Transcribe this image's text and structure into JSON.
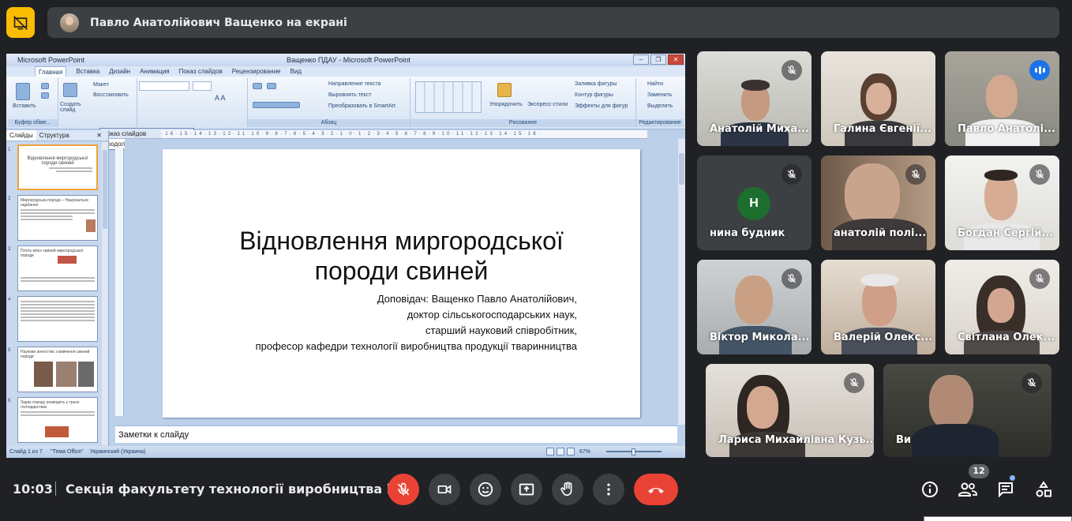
{
  "colors": {
    "accent_yellow": "#fbbc04",
    "end_call": "#ea4335",
    "speaking": "#1a73e8",
    "background": "#202124"
  },
  "presenter_bar": {
    "text": "Павло Анатолійович Ващенко на екрані"
  },
  "powerpoint": {
    "app_name": "Microsoft PowerPoint",
    "window_title": "Ващенко ПДАУ - Microsoft PowerPoint",
    "tabs": [
      "Главная",
      "Вставка",
      "Дизайн",
      "Анимация",
      "Показ слайдов",
      "Рецензирование",
      "Вид"
    ],
    "ribbon": {
      "paste": "Вставить",
      "create_slide": "Создать слайд",
      "maket": "Макет",
      "restore": "Восстановить",
      "clipboard_group": "Буфер обме...",
      "paragraph_group": "Абзац",
      "drawing_group": "Рисование",
      "editing_group": "Редактирование",
      "text_direction": "Направление текста",
      "align_text": "Выровнять текст",
      "smartart": "Преобразовать в SmartArt",
      "arrange": "Упорядочить",
      "quick_styles": "Экспресс-стили",
      "shape_fill": "Заливка фигуры",
      "shape_outline": "Контур фигуры",
      "shape_effects": "Эффекты для фигур",
      "find": "Найти",
      "replace": "Заменить",
      "select": "Выделить"
    },
    "popup": {
      "header": "Показ слайдов",
      "item": "Продолжить показ слайдов"
    },
    "side_tabs": {
      "slides": "Слайды",
      "outline": "Структура"
    },
    "thumbnails": [
      {
        "num": "1",
        "title": "Відновлення миргородської породи свиней"
      },
      {
        "num": "2",
        "title": "Миргородська порода – Національне надбання"
      },
      {
        "num": "3",
        "title": "Плоть мясо свиней миргородської породи"
      },
      {
        "num": "4",
        "title": ""
      },
      {
        "num": "5",
        "title": "Наукове агентство з вивчення свиней породи"
      },
      {
        "num": "6",
        "title": "Зараз породу розводять у трьох господарствах"
      }
    ],
    "ruler_text": "·16·15·14·13·12·11·10·9·8·7·6·5·4·3·2·1·0·1·2·3·4·5·6·7·8·9·10·11·12·13·14·15·16·",
    "slide": {
      "title_line1": "Відновлення миргородської",
      "title_line2": "породи свиней",
      "sub_line1": "Доповідач: Ващенко Павло Анатолійович,",
      "sub_line2": "доктор сільськогосподарських наук,",
      "sub_line3": "старший науковий співробітник,",
      "sub_line4": "професор кафедри технології виробництва продукції тваринництва"
    },
    "notes_placeholder": "Заметки к слайду",
    "status": {
      "slide_of": "Слайд 1 из 7",
      "theme": "\"Тема Office\"",
      "language": "Украинский (Украина)",
      "zoom": "67%"
    }
  },
  "participants": [
    {
      "name": "Анатолій Миха...",
      "muted": true
    },
    {
      "name": "Галина Євгенії...",
      "muted": false
    },
    {
      "name": "Павло Анатолі...",
      "muted": false,
      "speaking": true
    },
    {
      "name": "нина будник",
      "muted": true,
      "initial": "Н"
    },
    {
      "name": "анатолій полі...",
      "muted": true
    },
    {
      "name": "Богдан Сергій...",
      "muted": true
    },
    {
      "name": "Віктор Микола...",
      "muted": true
    },
    {
      "name": "Валерій Олекс...",
      "muted": false
    },
    {
      "name": "Світлана Олек...",
      "muted": true
    },
    {
      "name": "Лариса Михайлівна Кузь...",
      "muted": true
    },
    {
      "name": "Ви",
      "muted": true
    }
  ],
  "bottom": {
    "time": "10:03",
    "meeting_title": "Секція факультету технології виробництва і...",
    "people_count": "12"
  }
}
